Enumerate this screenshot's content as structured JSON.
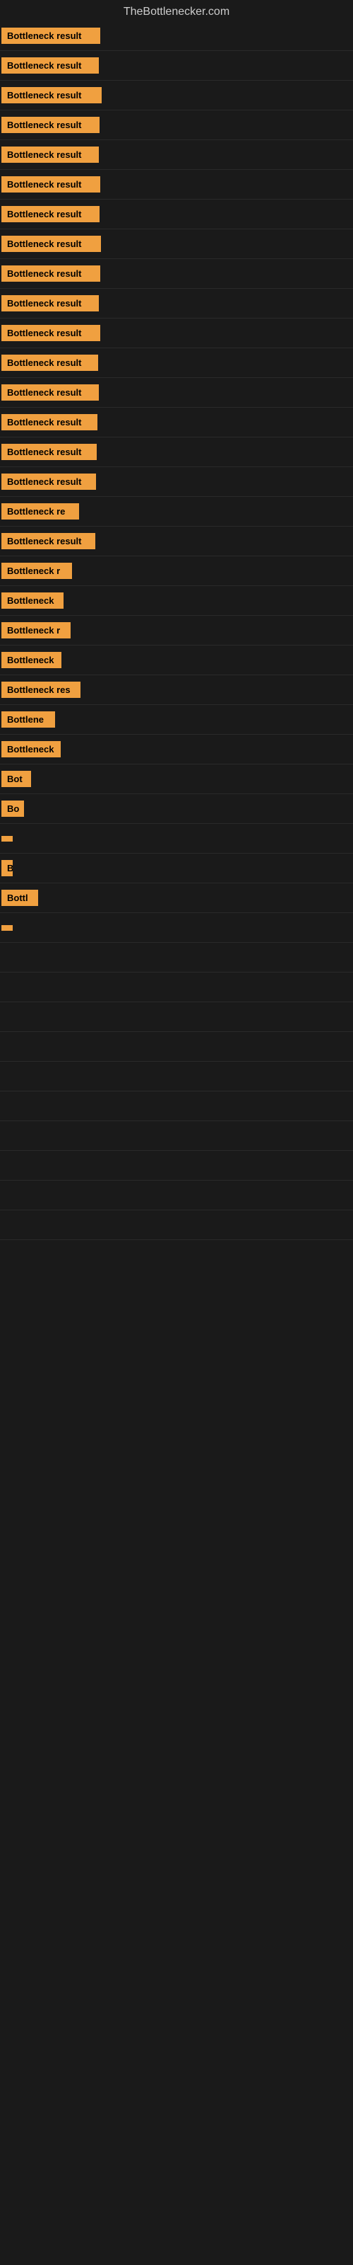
{
  "site": {
    "title": "TheBottlenecker.com"
  },
  "rows": [
    {
      "label": "Bottleneck result",
      "width": 140
    },
    {
      "label": "Bottleneck result",
      "width": 138
    },
    {
      "label": "Bottleneck result",
      "width": 142
    },
    {
      "label": "Bottleneck result",
      "width": 139
    },
    {
      "label": "Bottleneck result",
      "width": 138
    },
    {
      "label": "Bottleneck result",
      "width": 140
    },
    {
      "label": "Bottleneck result",
      "width": 139
    },
    {
      "label": "Bottleneck result",
      "width": 141
    },
    {
      "label": "Bottleneck result",
      "width": 140
    },
    {
      "label": "Bottleneck result",
      "width": 138
    },
    {
      "label": "Bottleneck result",
      "width": 140
    },
    {
      "label": "Bottleneck result",
      "width": 137
    },
    {
      "label": "Bottleneck result",
      "width": 138
    },
    {
      "label": "Bottleneck result",
      "width": 136
    },
    {
      "label": "Bottleneck result",
      "width": 135
    },
    {
      "label": "Bottleneck result",
      "width": 134
    },
    {
      "label": "Bottleneck re",
      "width": 110
    },
    {
      "label": "Bottleneck result",
      "width": 133
    },
    {
      "label": "Bottleneck r",
      "width": 100
    },
    {
      "label": "Bottleneck",
      "width": 88
    },
    {
      "label": "Bottleneck r",
      "width": 98
    },
    {
      "label": "Bottleneck",
      "width": 85
    },
    {
      "label": "Bottleneck res",
      "width": 112
    },
    {
      "label": "Bottlene",
      "width": 76
    },
    {
      "label": "Bottleneck",
      "width": 84
    },
    {
      "label": "Bot",
      "width": 42
    },
    {
      "label": "Bo",
      "width": 32
    },
    {
      "label": "",
      "width": 10
    },
    {
      "label": "B",
      "width": 16
    },
    {
      "label": "Bottl",
      "width": 52
    },
    {
      "label": "",
      "width": 8
    },
    {
      "label": "",
      "width": 0
    },
    {
      "label": "",
      "width": 0
    },
    {
      "label": "",
      "width": 0
    },
    {
      "label": "",
      "width": 0
    },
    {
      "label": "",
      "width": 0
    },
    {
      "label": "",
      "width": 0
    },
    {
      "label": "",
      "width": 0
    },
    {
      "label": "",
      "width": 0
    },
    {
      "label": "",
      "width": 0
    },
    {
      "label": "",
      "width": 0
    }
  ]
}
